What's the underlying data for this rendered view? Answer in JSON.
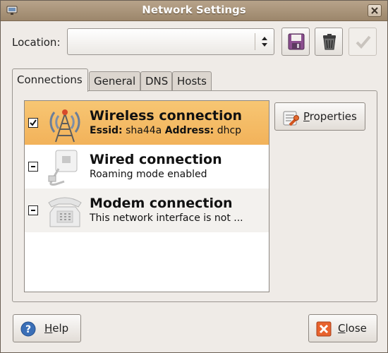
{
  "window": {
    "title": "Network Settings"
  },
  "location": {
    "label": "Location:",
    "value": ""
  },
  "tabs": [
    {
      "label": "Connections",
      "active": true
    },
    {
      "label": "General",
      "active": false
    },
    {
      "label": "DNS",
      "active": false
    },
    {
      "label": "Hosts",
      "active": false
    }
  ],
  "connections": [
    {
      "name": "Wireless connection",
      "detail_essid_label": "Essid:",
      "detail_essid_value": "sha44a",
      "detail_address_label": "Address:",
      "detail_address_value": "dhcp",
      "checked": true,
      "icon": "wireless-tower-icon"
    },
    {
      "name": "Wired connection",
      "detail": "Roaming mode enabled",
      "checked": false,
      "icon": "ethernet-plug-icon"
    },
    {
      "name": "Modem connection",
      "detail": "This network interface is not ...",
      "checked": false,
      "icon": "telephone-modem-icon"
    }
  ],
  "buttons": {
    "properties_prefix": "",
    "properties_mnemonic": "P",
    "properties_rest": "roperties",
    "help_mnemonic": "H",
    "help_rest": "elp",
    "close_mnemonic": "C",
    "close_rest": "lose"
  },
  "colors": {
    "titlebar": "#a8947a",
    "selection": "#f4bb64",
    "window_bg": "#efebe7"
  }
}
